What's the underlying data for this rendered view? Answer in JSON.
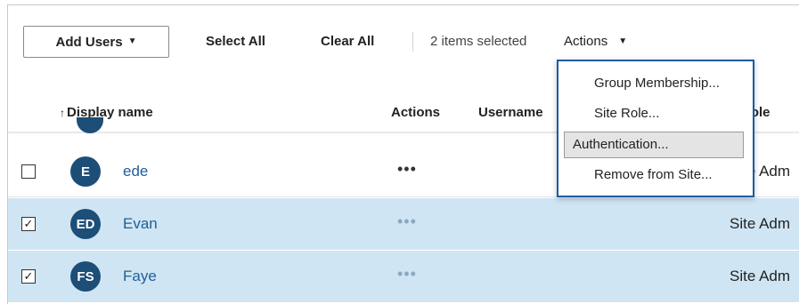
{
  "toolbar": {
    "add_users": "Add Users",
    "select_all": "Select All",
    "clear_all": "Clear All",
    "selected_count": "2 items selected",
    "actions": "Actions"
  },
  "table": {
    "headers": {
      "display_name": "Display name",
      "actions": "Actions",
      "username": "Username",
      "site_role": "role"
    },
    "rows": [
      {
        "initials": "E",
        "name": "ede",
        "actions": "•••",
        "site_role": "Site Adm",
        "checked": false
      },
      {
        "initials": "ED",
        "name": "Evan",
        "actions": "•••",
        "site_role": "Site Adm",
        "checked": true
      },
      {
        "initials": "FS",
        "name": "Faye",
        "actions": "•••",
        "site_role": "Site Adm",
        "checked": true
      }
    ]
  },
  "dropdown": {
    "items": [
      "Group Membership...",
      "Site Role...",
      "Authentication...",
      "Remove from Site..."
    ],
    "highlighted": "Authentication..."
  },
  "icons": {
    "sort": "sort-up-icon",
    "caret": "caret-down-icon",
    "check": "✓"
  },
  "colors": {
    "selected_row": "#cfe5f3",
    "avatar": "#1c4e77",
    "link": "#1f5f99",
    "menu_border": "#1d5aa6"
  }
}
